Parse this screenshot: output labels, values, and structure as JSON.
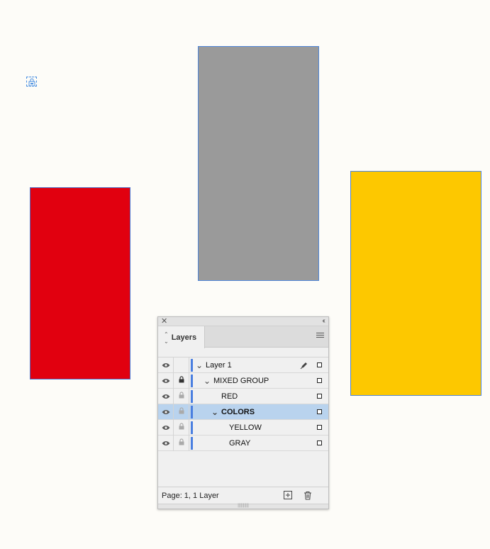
{
  "canvas": {
    "background": "#fdfcf8",
    "shapes": [
      {
        "name": "RED",
        "fill": "#e1000f"
      },
      {
        "name": "GRAY",
        "fill": "#9a9a9a"
      },
      {
        "name": "YELLOW",
        "fill": "#fdc800"
      }
    ],
    "lock_marker_icon": "lock-icon"
  },
  "panel": {
    "close_icon": "close-icon",
    "collapse_icon": "double-chevron-left-icon",
    "tab_label": "Layers",
    "menu_icon": "hamburger-menu-icon",
    "layers": [
      {
        "label": "Layer 1",
        "bold": false,
        "locked": false,
        "expanded": true,
        "selected": false,
        "pen": true
      },
      {
        "label": "MIXED GROUP",
        "bold": false,
        "locked": true,
        "expanded": true,
        "selected": false,
        "pen": false
      },
      {
        "label": "RED",
        "bold": false,
        "locked": "dim",
        "expanded": null,
        "selected": false,
        "pen": false
      },
      {
        "label": "COLORS",
        "bold": true,
        "locked": "dim",
        "expanded": true,
        "selected": true,
        "pen": false
      },
      {
        "label": "YELLOW",
        "bold": false,
        "locked": "dim",
        "expanded": null,
        "selected": false,
        "pen": false
      },
      {
        "label": "GRAY",
        "bold": false,
        "locked": "dim",
        "expanded": null,
        "selected": false,
        "pen": false
      }
    ],
    "footer_status": "Page: 1, 1 Layer",
    "new_layer_icon": "new-layer-icon",
    "delete_icon": "trash-icon",
    "layer_color": "#4a7fe0",
    "selected_color": "#b9d3ee"
  }
}
